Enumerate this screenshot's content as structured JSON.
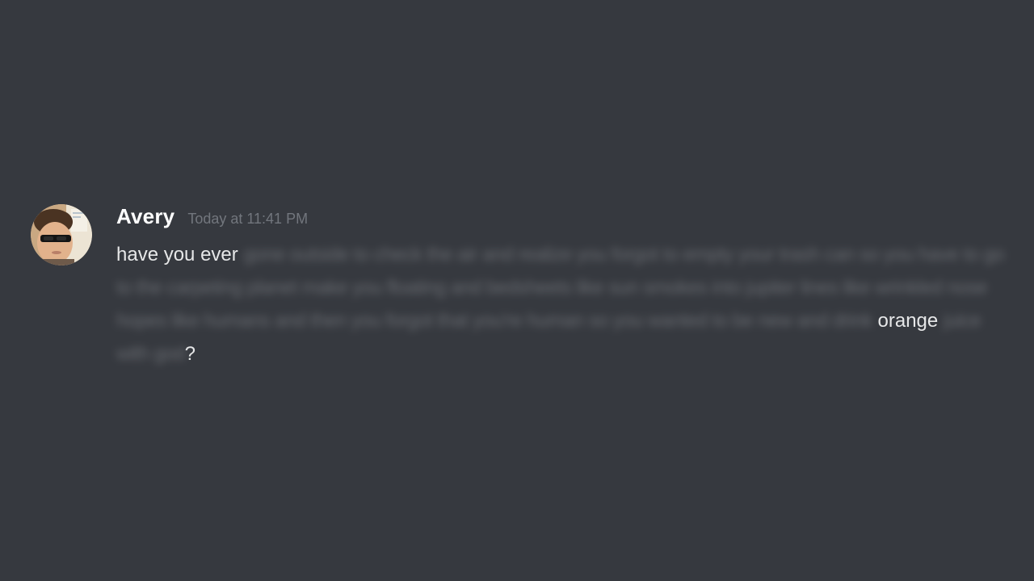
{
  "message": {
    "author": "Avery",
    "timestamp": "Today at 11:41 PM",
    "avatar_icon": "user-avatar-sunglasses",
    "content": {
      "visible_start": "have you ever",
      "visible_middle": "orange",
      "visible_end": "?"
    }
  },
  "colors": {
    "background": "#36393f",
    "username": "#ffffff",
    "timestamp": "#72767d",
    "text": "#dcddde"
  }
}
